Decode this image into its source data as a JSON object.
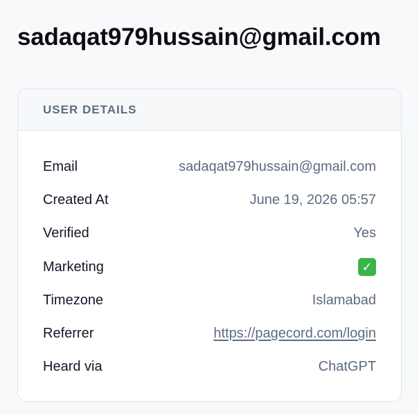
{
  "page": {
    "title": "sadaqat979hussain@gmail.com"
  },
  "card": {
    "header": "USER DETAILS",
    "rows": [
      {
        "label": "Email",
        "value": "sadaqat979hussain@gmail.com",
        "kind": "text"
      },
      {
        "label": "Created At",
        "value": "June 19, 2026 05:57",
        "kind": "text"
      },
      {
        "label": "Verified",
        "value": "Yes",
        "kind": "text"
      },
      {
        "label": "Marketing",
        "value": true,
        "kind": "check",
        "icon": "check-mark-button-icon",
        "color": "#3bb54a"
      },
      {
        "label": "Timezone",
        "value": "Islamabad",
        "kind": "text"
      },
      {
        "label": "Referrer",
        "value": "https://pagecord.com/login",
        "kind": "link"
      },
      {
        "label": "Heard via",
        "value": "ChatGPT",
        "kind": "text"
      }
    ]
  },
  "colors": {
    "background": "#f8f9fb",
    "title": "#0b0d12",
    "muted": "#5c6b80",
    "border": "#dfe3ea"
  }
}
